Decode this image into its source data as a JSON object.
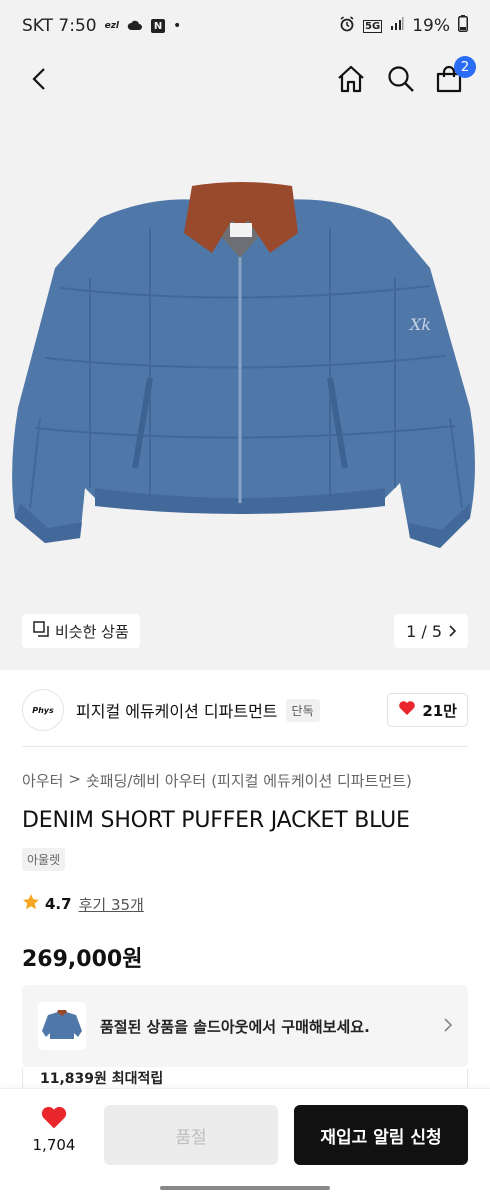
{
  "status_bar": {
    "carrier_time": "SKT 7:50",
    "icons": [
      "ezl-icon",
      "cloud-icon",
      "n-app-icon",
      "dot-icon",
      "alarm-icon",
      "5g-icon",
      "signal-icon",
      "battery-icon"
    ],
    "network": "5G",
    "battery": "19%"
  },
  "nav": {
    "icons": [
      "back-icon",
      "home-icon",
      "search-icon",
      "cart-icon"
    ],
    "cart_count": "2"
  },
  "gallery": {
    "similar_label": "비슷한 상품",
    "pager": "1 / 5"
  },
  "brand": {
    "logo_text": "Phys",
    "name": "피지컬 에듀케이션 디파트먼트",
    "tag": "단독",
    "likes": "21만"
  },
  "product": {
    "breadcrumb": [
      "아우터",
      "숏패딩/헤비 아우터",
      "(피지컬 에듀케이션 디파트먼트)"
    ],
    "title": "DENIM SHORT PUFFER JACKET BLUE",
    "badge": "아울렛",
    "rating": "4.7",
    "reviews": "후기 35개",
    "price": "269,000원"
  },
  "soldout_card": {
    "text": "품절된 상품을 솔드아웃에서 구매해보세요.",
    "points": "11,839원 최대적립"
  },
  "bottom_bar": {
    "wish_count": "1,704",
    "soldout_label": "품절",
    "restock_label": "재입고 알림 신청"
  },
  "colors": {
    "accent_badge": "#2a6df4",
    "heart": "#e8262b",
    "denim": "#4f77a8",
    "collar": "#9a4a2c",
    "star": "#f5a623"
  }
}
